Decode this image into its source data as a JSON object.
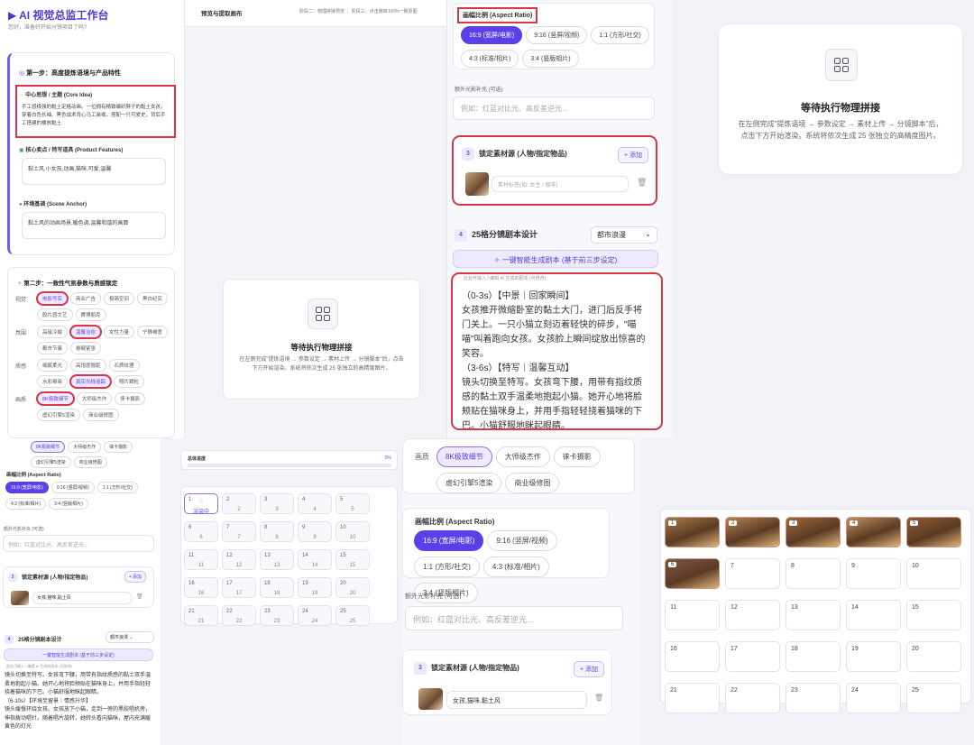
{
  "app": {
    "title": "AI 视觉总监工作台",
    "subtitle": "您好，准备好开始分镜项目了吗?"
  },
  "canvas_header": {
    "title": "预览与提取画布",
    "steps": "阶段二：物理拼接预览 ｜ 阶段三：点击跳转100%一致原图"
  },
  "step1": {
    "title": "第一步：高度提炼语境与产品特性",
    "core_label": "中心思想 / 主题 (Core Idea)",
    "core_text": "手工感极强的黏土定格动画。一位拥有精致编织胖子的黏土女孩，穿着白色长袖、黑色战术背心马工装裤，搭配一只可爱史，背后手工搭建的楼放黏土",
    "features_label": "核心卖点 / 特写道具 (Product Features)",
    "features_text": "黏土风,小女孩,动画,猫咪,可爱,温馨",
    "scene_label": "环境基调 (Scene Anchor)",
    "scene_text": "黏土风的动画场景,暖色调,温馨和谐的画面"
  },
  "step2": {
    "title": "第二步：一致性气氛参数与质感锁定",
    "rows": [
      {
        "label": "视觉",
        "chips": [
          "电影写实",
          "商业广告",
          "极简空间",
          "黑白纪实",
          "胶片感文艺",
          "赛博朋克"
        ],
        "sel": 0
      },
      {
        "label": "氛围",
        "chips": [
          "高级冷峻",
          "温馨治愈",
          "女性力量",
          "宁静禅意",
          "都市节奏",
          "悬疑紧张"
        ],
        "sel": 1
      },
      {
        "label": "质感",
        "chips": [
          "细腻柔光",
          "高饱度微距",
          "石质纹理",
          "水彩晕染",
          "真实光线追踪",
          "照片颗粒"
        ],
        "sel": 4
      },
      {
        "label": "画质",
        "chips": [
          "8K极致细节",
          "大师级杰作",
          "徕卡摄影",
          "虚幻引擎5渲染",
          "商业级修图"
        ],
        "sel": 0
      }
    ]
  },
  "aspect": {
    "label": "画幅比例 (Aspect Ratio)",
    "options": [
      "16:9 (宽屏/电影)",
      "9:16 (竖屏/视频)",
      "1:1 (方形/社交)",
      "4:3 (标准/相片)",
      "3:4 (竖版相片)"
    ]
  },
  "light": {
    "label": "额外光影补充 (可选)",
    "placeholder": "例如：红蓝对比光、高反差逆光..."
  },
  "assets": {
    "num": "3",
    "title": "锁定素材源 (人物/指定物品)",
    "add": "+ 添加",
    "placeholder": "素材标签(如: 女主 / 咖啡)",
    "tag_value": "女孩,猫咪,黏土风"
  },
  "storyboard": {
    "num": "4",
    "title": "25格分镜剧本设计",
    "style": "都市浪漫",
    "gen_btn": "一键智能生成剧本 (基于前三步设定)",
    "hint": "此处可输入 / 编辑 AI 生成的剧本 (可修改)",
    "script": [
      "（0-3s）【中景｜回家瞬间】",
      "女孩推开微缩卧室的黏土大门，进门后反手将门关上。一只小猫立刻迈着轻快的碎步，\"喵喵\"叫着跑向女孩。女孩脸上瞬间绽放出惊喜的笑容。",
      "（3-6s）【特写｜温馨互动】",
      "镜头切换至特写。女孩弯下腰，用带有指纹质感的黏土双手温柔地抱起小猫。她开心地将脸颊贴在猫咪身上，并用手指轻轻挠着猫咪的下巴。小猫舒服地眯起眼睛。",
      "（6-10s）【环境至留景｜情感升华】",
      "镜头缓慢环绕女孩。女孩放下小猫，走到一旁的黑胶唱机旁，伸指拨动唱针。随着唱片旋转，她转头看向猫咪，屋内充满暖黄色"
    ],
    "script_tail": [
      "镜头切换至特写。女孩弯下腰，用带有指纹质感的黏土双手温柔地抱起小猫。她开心地将脸颊贴在猫咪身上，并用手指轻轻挠着猫咪的下巴。小猫舒服地眯起眼睛。",
      "（6-10s）【环境至留景｜情感升华】",
      "镜头缓慢环绕女孩。女孩放下小猫，走到一旁的黑胶唱机旁，伸指拨动唱针。随着唱片旋转，她转头看向猫咪，屋内充满暖黄色的灯光"
    ]
  },
  "waiting": {
    "title": "等待执行物理拼接",
    "desc": "在左侧完成\"提炼语境 → 参数设定 → 素材上传 → 分镜脚本\"后，点击下方开始渲染。系统将依次生成 25 张独立的高精度图片。"
  },
  "progress": {
    "label": "总体进度",
    "value": "0%",
    "rendering": "渲染中"
  },
  "grid_numbers": [
    "1",
    "2",
    "3",
    "4",
    "5",
    "6",
    "7",
    "8",
    "9",
    "10",
    "11",
    "12",
    "13",
    "14",
    "15",
    "16",
    "17",
    "18",
    "19",
    "20",
    "21",
    "22",
    "23",
    "24",
    "25"
  ],
  "colors": {
    "accent": "#5b3fe8",
    "highlight": "#d9364a"
  }
}
